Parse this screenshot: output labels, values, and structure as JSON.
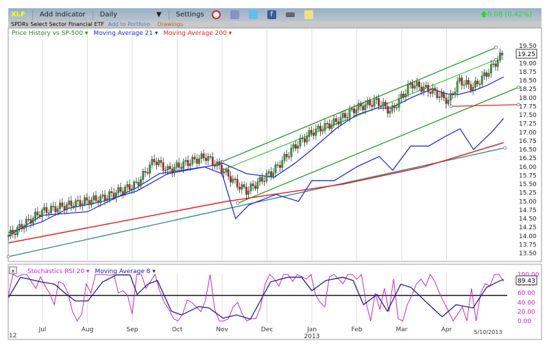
{
  "toolbar": {
    "ticker": "XLF",
    "add_indicator": "Add Indicator",
    "interval": "Daily",
    "settings": "Settings",
    "change": "0.08 (0.42%)",
    "icons": [
      "alarm-clock-icon",
      "portfolio-icon",
      "twitter-icon",
      "facebook-icon",
      "print-icon",
      "note-icon"
    ]
  },
  "subtitle": {
    "name": "SPDRs Select Sector Financial ETF",
    "add_to_portfolio": "Add to Portfolio",
    "drawings": "Drawings"
  },
  "colors": {
    "price_history": "#228822",
    "ma21": "#1a2ee0",
    "ma200": "#e82020",
    "stoch": "#cc22cc",
    "ma8": "#1c1c8c",
    "channel": "#229922",
    "inner": "#44cc44",
    "teal": "#228888"
  },
  "chart_data": {
    "type": "line",
    "main": {
      "legend": [
        "Price History vs SP-500",
        "Moving Average 21",
        "Moving Average 200"
      ],
      "y_ticks": [
        "19.50",
        "19.25",
        "19.00",
        "18.75",
        "18.50",
        "18.25",
        "18.00",
        "17.75",
        "17.50",
        "17.25",
        "17.00",
        "16.75",
        "16.50",
        "16.25",
        "16.00",
        "15.75",
        "15.50",
        "15.25",
        "15.00",
        "14.75",
        "14.50",
        "14.25",
        "14.00",
        "13.75",
        "13.50"
      ],
      "ylim": [
        13.5,
        19.5
      ],
      "last_price": "19.25",
      "price": [
        [
          0.24,
          14.0
        ],
        [
          0.97,
          14.7
        ],
        [
          1.58,
          14.9
        ],
        [
          2.34,
          15.1
        ],
        [
          3.1,
          15.5
        ],
        [
          3.49,
          16.2
        ],
        [
          3.79,
          15.9
        ],
        [
          4.18,
          16.1
        ],
        [
          4.63,
          16.3
        ],
        [
          4.94,
          16.0
        ],
        [
          5.32,
          15.5
        ],
        [
          5.55,
          15.3
        ],
        [
          5.85,
          15.6
        ],
        [
          6.16,
          15.9
        ],
        [
          6.62,
          16.6
        ],
        [
          7.0,
          17.0
        ],
        [
          7.53,
          17.3
        ],
        [
          7.99,
          17.7
        ],
        [
          8.45,
          17.9
        ],
        [
          8.76,
          17.6
        ],
        [
          9.21,
          18.4
        ],
        [
          9.67,
          18.2
        ],
        [
          10.05,
          17.9
        ],
        [
          10.28,
          18.5
        ],
        [
          10.59,
          18.3
        ],
        [
          10.89,
          18.7
        ],
        [
          11.27,
          19.3
        ]
      ],
      "ma21": [
        [
          0.24,
          14.1
        ],
        [
          0.97,
          14.4
        ],
        [
          1.58,
          14.8
        ],
        [
          2.34,
          15.0
        ],
        [
          3.1,
          15.3
        ],
        [
          3.79,
          15.8
        ],
        [
          4.63,
          16.0
        ],
        [
          5.02,
          16.1
        ],
        [
          5.55,
          15.8
        ],
        [
          6.16,
          15.7
        ],
        [
          6.62,
          16.1
        ],
        [
          7.0,
          16.5
        ],
        [
          7.53,
          17.1
        ],
        [
          7.99,
          17.5
        ],
        [
          8.45,
          17.7
        ],
        [
          8.76,
          17.7
        ],
        [
          9.21,
          18.0
        ],
        [
          9.67,
          18.25
        ],
        [
          10.05,
          18.1
        ],
        [
          10.28,
          18.1
        ],
        [
          10.59,
          18.2
        ],
        [
          10.89,
          18.35
        ],
        [
          11.27,
          18.6
        ]
      ],
      "ma200": [
        [
          0.24,
          13.8
        ],
        [
          5.1,
          15.0
        ],
        [
          7.7,
          15.5
        ],
        [
          9.5,
          16.0
        ],
        [
          11.27,
          16.7
        ]
      ],
      "sp500": [
        [
          0.24,
          14.0
        ],
        [
          1.0,
          14.6
        ],
        [
          2.0,
          14.7
        ],
        [
          3.1,
          15.4
        ],
        [
          3.6,
          15.8
        ],
        [
          4.6,
          16.0
        ],
        [
          5.0,
          15.8
        ],
        [
          5.3,
          14.5
        ],
        [
          5.6,
          14.9
        ],
        [
          6.2,
          15.2
        ],
        [
          6.7,
          15.0
        ],
        [
          7.0,
          15.6
        ],
        [
          7.5,
          15.6
        ],
        [
          8.0,
          16.0
        ],
        [
          8.5,
          16.3
        ],
        [
          8.8,
          15.9
        ],
        [
          9.2,
          16.6
        ],
        [
          9.6,
          16.6
        ],
        [
          10.0,
          16.9
        ],
        [
          10.3,
          17.1
        ],
        [
          10.6,
          16.5
        ],
        [
          11.0,
          17.0
        ],
        [
          11.27,
          17.4
        ]
      ],
      "drawings": [
        {
          "color": "channel",
          "from": [
            5.0,
            16.15
          ],
          "to": [
            11.1,
            19.45
          ]
        },
        {
          "color": "inner",
          "from": [
            5.0,
            15.9
          ],
          "to": [
            11.1,
            19.1
          ]
        },
        {
          "color": "channel",
          "from": [
            5.35,
            14.95
          ],
          "to": [
            11.6,
            18.3
          ]
        },
        {
          "color": "teal",
          "from": [
            0.24,
            13.4
          ],
          "to": [
            11.3,
            16.55
          ]
        },
        {
          "color": "ma200",
          "from": [
            10.1,
            17.75
          ],
          "to": [
            11.6,
            17.8
          ]
        }
      ]
    },
    "lower": {
      "legend": [
        "Stochastics RSI 20",
        "Moving Average 8"
      ],
      "y_ticks": [
        "100.00",
        "80.00",
        "60.00",
        "40.00",
        "20.00",
        "0.00"
      ],
      "ylim": [
        0,
        100
      ],
      "reference_line": 55,
      "last_value": "89.43",
      "stoch_range": [
        0.24,
        11.27
      ],
      "stoch": [
        55,
        100,
        95,
        100,
        100,
        85,
        70,
        95,
        75,
        60,
        35,
        85,
        80,
        60,
        20,
        0,
        15,
        80,
        60,
        100,
        100,
        100,
        98,
        100,
        60,
        65,
        55,
        15,
        100,
        100,
        70,
        85,
        100,
        65,
        40,
        25,
        5,
        0,
        15,
        45,
        40,
        30,
        20,
        45,
        100,
        25,
        0,
        0,
        5,
        30,
        40,
        15,
        0,
        5,
        5,
        30,
        80,
        100,
        90,
        75,
        100,
        100,
        85,
        100,
        95,
        90,
        100,
        55,
        40,
        30,
        95,
        100,
        90,
        80,
        100,
        100,
        90,
        100,
        40,
        0,
        60,
        25,
        70,
        20,
        90,
        5,
        0,
        35,
        55,
        80,
        90,
        75,
        100,
        85,
        60,
        40,
        20,
        0,
        15,
        30,
        0,
        70,
        0,
        60,
        80,
        75,
        100,
        100,
        85
      ],
      "ma8": [
        [
          0.24,
          50
        ],
        [
          0.51,
          94
        ],
        [
          0.97,
          84
        ],
        [
          1.27,
          79
        ],
        [
          1.5,
          60
        ],
        [
          1.73,
          43
        ],
        [
          2.01,
          43
        ],
        [
          2.34,
          84
        ],
        [
          2.65,
          99
        ],
        [
          2.95,
          99
        ],
        [
          3.11,
          57
        ],
        [
          3.34,
          79
        ],
        [
          3.56,
          87
        ],
        [
          3.87,
          21
        ],
        [
          4.1,
          13
        ],
        [
          4.48,
          31
        ],
        [
          4.71,
          28
        ],
        [
          5.02,
          6
        ],
        [
          5.32,
          13
        ],
        [
          5.63,
          4
        ],
        [
          5.85,
          43
        ],
        [
          6.08,
          84
        ],
        [
          6.47,
          94
        ],
        [
          6.77,
          94
        ],
        [
          7.0,
          65
        ],
        [
          7.31,
          87
        ],
        [
          7.69,
          94
        ],
        [
          7.92,
          87
        ],
        [
          8.15,
          35
        ],
        [
          8.45,
          57
        ],
        [
          8.68,
          21
        ],
        [
          8.98,
          79
        ],
        [
          9.21,
          72
        ],
        [
          9.52,
          43
        ],
        [
          9.9,
          9
        ],
        [
          10.21,
          35
        ],
        [
          10.59,
          28
        ],
        [
          10.89,
          72
        ],
        [
          11.2,
          87
        ],
        [
          11.27,
          89
        ]
      ]
    },
    "x_ticks": [
      {
        "m": 1,
        "label": "Jul"
      },
      {
        "m": 2,
        "label": "Aug"
      },
      {
        "m": 3,
        "label": "Sep"
      },
      {
        "m": 4,
        "label": "Oct"
      },
      {
        "m": 5,
        "label": "Nov"
      },
      {
        "m": 6,
        "label": "Dec"
      },
      {
        "m": 7,
        "label": "Jan"
      },
      {
        "m": 8,
        "label": "Feb"
      },
      {
        "m": 9,
        "label": "Mar"
      },
      {
        "m": 10,
        "label": "Apr"
      }
    ],
    "year_start": "12",
    "year_label": "2013",
    "end_date": "5/10/2013"
  }
}
